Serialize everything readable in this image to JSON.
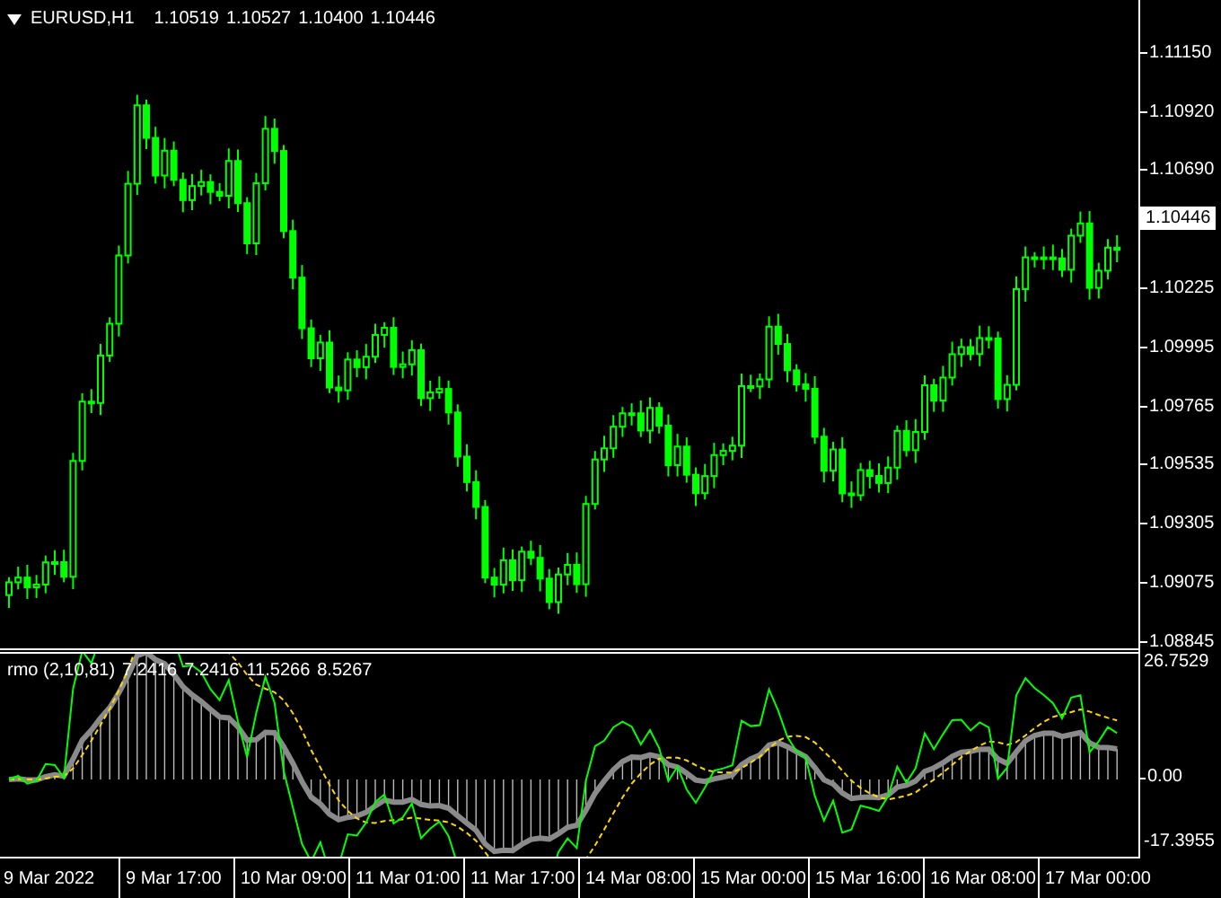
{
  "chart": {
    "header": {
      "symbol": "EURUSD,H1",
      "ohlc": [
        "1.10519",
        "1.10527",
        "1.10400",
        "1.10446"
      ]
    },
    "price_axis": [
      {
        "kind": "tick",
        "text": "1.11150"
      },
      {
        "kind": "tick",
        "text": "1.10920"
      },
      {
        "kind": "tick",
        "text": "1.10690"
      },
      {
        "kind": "current",
        "text": "1.10446"
      },
      {
        "kind": "tick",
        "text": "1.10225"
      },
      {
        "kind": "tick",
        "text": "1.09995"
      },
      {
        "kind": "tick",
        "text": "1.09765"
      },
      {
        "kind": "tick",
        "text": "1.09535"
      },
      {
        "kind": "tick",
        "text": "1.09305"
      },
      {
        "kind": "tick",
        "text": "1.09075"
      },
      {
        "kind": "tick",
        "text": "1.08845"
      }
    ]
  },
  "indicator": {
    "label": "rmo (2,10,81)",
    "values": [
      "7.2416",
      "7.2416",
      "11.5266",
      "8.5267"
    ],
    "axis": [
      "26.7529",
      "0.00",
      "-17.3955"
    ]
  },
  "time_axis": [
    "9 Mar 2022",
    "9 Mar 17:00",
    "10 Mar 09:00",
    "11 Mar 01:00",
    "11 Mar 17:00",
    "14 Mar 08:00",
    "15 Mar 00:00",
    "15 Mar 16:00",
    "16 Mar 08:00",
    "17 Mar 00:00"
  ]
}
